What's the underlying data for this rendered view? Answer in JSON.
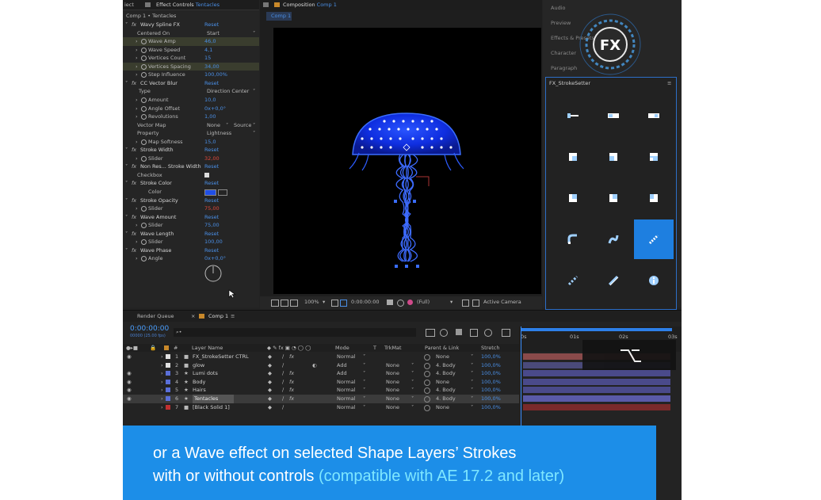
{
  "effect_controls": {
    "tab_prev": "iect",
    "tab_label": "Effect Controls",
    "tab_layer": "Tentacles",
    "breadcrumb": "Comp 1 • Tentacles",
    "rows": [
      {
        "label": "Wavy Spline FX",
        "value": "Reset",
        "kind": "fx"
      },
      {
        "label": "Centered On",
        "value": "Start",
        "kind": "dropdown"
      },
      {
        "label": "Wave Amp",
        "value": "46,0",
        "kind": "param",
        "hl": true
      },
      {
        "label": "Wave Speed",
        "value": "4,1",
        "kind": "param"
      },
      {
        "label": "Vertices Count",
        "value": "15",
        "kind": "param"
      },
      {
        "label": "Vertices Spacing",
        "value": "34,00",
        "kind": "param",
        "hl": true
      },
      {
        "label": "Step Influence",
        "value": "100,00%",
        "kind": "param"
      },
      {
        "label": "CC Vector Blur",
        "value": "Reset",
        "kind": "fx"
      },
      {
        "label": "Type",
        "value": "Direction Center",
        "kind": "dropdown"
      },
      {
        "label": "Amount",
        "value": "10,0",
        "kind": "param"
      },
      {
        "label": "Angle Offset",
        "value": "0x+0,0°",
        "kind": "param"
      },
      {
        "label": "Revolutions",
        "value": "1,00",
        "kind": "param"
      },
      {
        "label": "Vector Map",
        "value": "None",
        "extra": "Source",
        "kind": "dropdown2"
      },
      {
        "label": "Property",
        "value": "Lightness",
        "kind": "dropdown"
      },
      {
        "label": "Map Softness",
        "value": "15,0",
        "kind": "param"
      },
      {
        "label": "Stroke Width",
        "value": "Reset",
        "kind": "fx"
      },
      {
        "label": "Slider",
        "value": "32,00",
        "kind": "param",
        "red": true
      },
      {
        "label": "Non Res... Stroke Width",
        "value": "Reset",
        "kind": "fx"
      },
      {
        "label": "Checkbox",
        "value": "",
        "kind": "checkbox"
      },
      {
        "label": "Stroke Color",
        "value": "Reset",
        "kind": "fx"
      },
      {
        "label": "Color",
        "value": "",
        "kind": "color"
      },
      {
        "label": "Stroke Opacity",
        "value": "Reset",
        "kind": "fx"
      },
      {
        "label": "Slider",
        "value": "75,00",
        "kind": "param",
        "red": true
      },
      {
        "label": "Wave Amount",
        "value": "Reset",
        "kind": "fx"
      },
      {
        "label": "Slider",
        "value": "75,00",
        "kind": "param"
      },
      {
        "label": "Wave Length",
        "value": "Reset",
        "kind": "fx"
      },
      {
        "label": "Slider",
        "value": "100,00",
        "kind": "param"
      },
      {
        "label": "Wave Phase",
        "value": "Reset",
        "kind": "fx"
      },
      {
        "label": "Angle",
        "value": "0x+0,0°",
        "kind": "param"
      }
    ]
  },
  "composition": {
    "tab_label": "Composition",
    "tab_comp": "Comp 1",
    "subtab": "Comp 1",
    "zoom": "100%",
    "timecode": "0:00:00:00",
    "resolution": "(Full)",
    "camera": "Active Camera"
  },
  "right_panel": {
    "menu": [
      "Audio",
      "Preview",
      "Effects & Presets",
      "Character",
      "Paragraph"
    ],
    "logo_text": "FX",
    "panel_title": "FX_StrokeSetter",
    "active_index": 11
  },
  "timeline": {
    "render_queue": "Render Queue",
    "tab": "Comp 1",
    "timecode": "0:00:00:00",
    "timecode_sub": "00000 (25.00 fps)",
    "search_placeholder": "⌕•",
    "columns": {
      "layer_name": "Layer Name",
      "mode": "Mode",
      "t": "T",
      "trkmat": "TrkMat",
      "parent": "Parent & Link",
      "stretch": "Stretch"
    },
    "ruler": [
      "0s",
      "01s",
      "02s",
      "03s"
    ],
    "layers": [
      {
        "num": "1",
        "name": "FX_StrokeSetter CTRL",
        "mode": "Normal",
        "trkmat": "",
        "parent": "None",
        "stretch": "100,0%",
        "label_color": "#e0e0e0",
        "bar": "#8a4a4a",
        "star": false
      },
      {
        "num": "2",
        "name": "glow",
        "mode": "Add",
        "trkmat": "None",
        "parent": "4. Body",
        "stretch": "100,0%",
        "label_color": "#e0e0e0",
        "bar": "#4a4a7a",
        "star": false
      },
      {
        "num": "3",
        "name": "Lumi dots",
        "mode": "Add",
        "trkmat": "None",
        "parent": "4. Body",
        "stretch": "100,0%",
        "label_color": "#5a6fd8",
        "bar": "#4a4a8a",
        "star": true
      },
      {
        "num": "4",
        "name": "Body",
        "mode": "Normal",
        "trkmat": "None",
        "parent": "None",
        "stretch": "100,0%",
        "label_color": "#5a6fd8",
        "bar": "#4a4a8a",
        "star": true
      },
      {
        "num": "5",
        "name": "Hairs",
        "mode": "Normal",
        "trkmat": "None",
        "parent": "4. Body",
        "stretch": "100,0%",
        "label_color": "#5a6fd8",
        "bar": "#4a4a8a",
        "star": true
      },
      {
        "num": "6",
        "name": "Tentacles",
        "mode": "Normal",
        "trkmat": "None",
        "parent": "4. Body",
        "stretch": "100,0%",
        "label_color": "#5a6fd8",
        "bar": "#5a5aa8",
        "star": true,
        "selected": true
      },
      {
        "num": "7",
        "name": "[Black Solid 1]",
        "mode": "Normal",
        "trkmat": "None",
        "parent": "None",
        "stretch": "100,0%",
        "label_color": "#c03030",
        "bar": "#7a2a2a",
        "star": false
      }
    ]
  },
  "banner": {
    "line1": "or a Wave effect on selected Shape Layers’ Strokes",
    "line2_main": "with or without controls ",
    "line2_highlight": "(compatible with AE 17.2 and later)"
  }
}
